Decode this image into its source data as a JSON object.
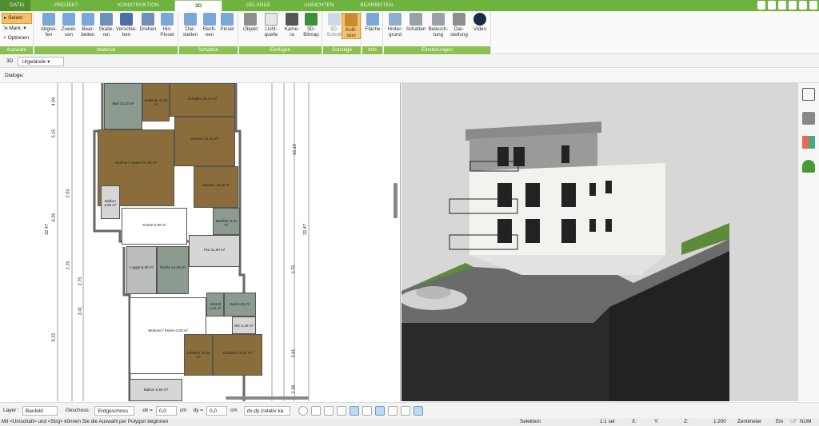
{
  "tabs": {
    "items": [
      "DATEI",
      "PROJEKT",
      "KONSTRUKTION",
      "3D",
      "GELÄNDE",
      "ANSICHTEN",
      "BEARBEITEN"
    ]
  },
  "auswahl": {
    "selekt": "Selekt",
    "mark": "Mark.",
    "optionen": "Optionen",
    "label": "Auswahl"
  },
  "material": {
    "label": "Material",
    "buttons": [
      "Abgrei-\nfen",
      "Zuwei-\nsen",
      "Bear-\nbeiten",
      "Skalie-\nren",
      "Verschie-\nben",
      "Drehen",
      "Hin.\nPinsel"
    ]
  },
  "schatten": {
    "label": "Schatten",
    "buttons": [
      "Dar-\nstellen",
      "Rech-\nnen",
      "Pinsel"
    ]
  },
  "einfuegen": {
    "label": "Einfügen",
    "buttons": [
      "Objekt",
      "Licht-\nquelle",
      "Kame-\nra",
      "3D-\nBitmap"
    ]
  },
  "sonstige": {
    "label": "Sonstige",
    "buttons": [
      "3D-\nSchnitt",
      "Kolli-\nsion"
    ]
  },
  "info": {
    "label": "Info",
    "buttons": [
      "Fläche"
    ]
  },
  "einstellungen": {
    "label": "Einstellungen",
    "buttons": [
      "Hinter-\ngrund",
      "Schatten",
      "Beleuch-\ntung",
      "Dar-\nstellung",
      "Video"
    ]
  },
  "viewbar": {
    "mode": "3D",
    "layer_select": "Urgelände"
  },
  "dialog": {
    "label": "Dialoge:"
  },
  "plan": {
    "rooms": [
      {
        "name": "Bad\n14,22 m²"
      },
      {
        "name": "Ankleide\n11,34 m²"
      },
      {
        "name": "Schlafen\n22,74 m²"
      },
      {
        "name": "Zimmer\n22,22 m²"
      },
      {
        "name": "Wohnen / Essen\n67,60 m²"
      },
      {
        "name": "Arbeiten\n14,28 m²"
      },
      {
        "name": "Balkon\n2,95 m²"
      },
      {
        "name": "Küche\n0,00 m²"
      },
      {
        "name": "Bad/WC\n5,31 m²"
      },
      {
        "name": "Flur\n11,90 m²"
      },
      {
        "name": "Loggia\n6,38 m²"
      },
      {
        "name": "Küche\n14,29 m²"
      },
      {
        "name": "Wohnen / Essen\n0,00 m²"
      },
      {
        "name": "Abstell\n2,44 m²"
      },
      {
        "name": "Bad\n6,35 m²"
      },
      {
        "name": "WC\n2,49 m²"
      },
      {
        "name": "Arbeiten\n10,62 m²"
      },
      {
        "name": "Schlafen\n15,07 m²"
      },
      {
        "name": "Balkon\n5,59 m²"
      }
    ],
    "dims_left": [
      "4.59",
      "5.15",
      "2.03",
      "6.26",
      "2.25",
      "2.75",
      "3.41",
      "8.22",
      "32.47"
    ],
    "dims_right": [
      "16.19",
      "32.47",
      "2.75",
      "3.81",
      "2.38"
    ]
  },
  "bottombar": {
    "layer_label": "Layer :",
    "layer_value": "Baufeld",
    "geschoss_label": "Geschoss :",
    "geschoss_value": "Erdgeschoss",
    "dx_label": "dx =",
    "dx_value": "0,0",
    "dx_unit": "cm",
    "dy_label": "dy =",
    "dy_value": "0,0",
    "dy_unit": "cm",
    "mode": "dx,dy (relativ ka"
  },
  "status": {
    "hint": "Mit <Umschalt> und <Strg> können Sie die Auswahl per Polygon beginnen",
    "mode": "Selektion",
    "sel": "1:1 sel",
    "x": "X:",
    "y": "Y:",
    "z": "Z:",
    "scale": "1:200",
    "unit": "Zentimeter",
    "ein": "Ein",
    "uf": "UF",
    "num": "NUM"
  },
  "colors": {
    "ribbon_green": "#6fb33f",
    "group_label_green": "#8cc04f",
    "active_button": "#f4c16a",
    "room_brown": "#8a6d3b",
    "room_gray": "#8c9a8f"
  }
}
